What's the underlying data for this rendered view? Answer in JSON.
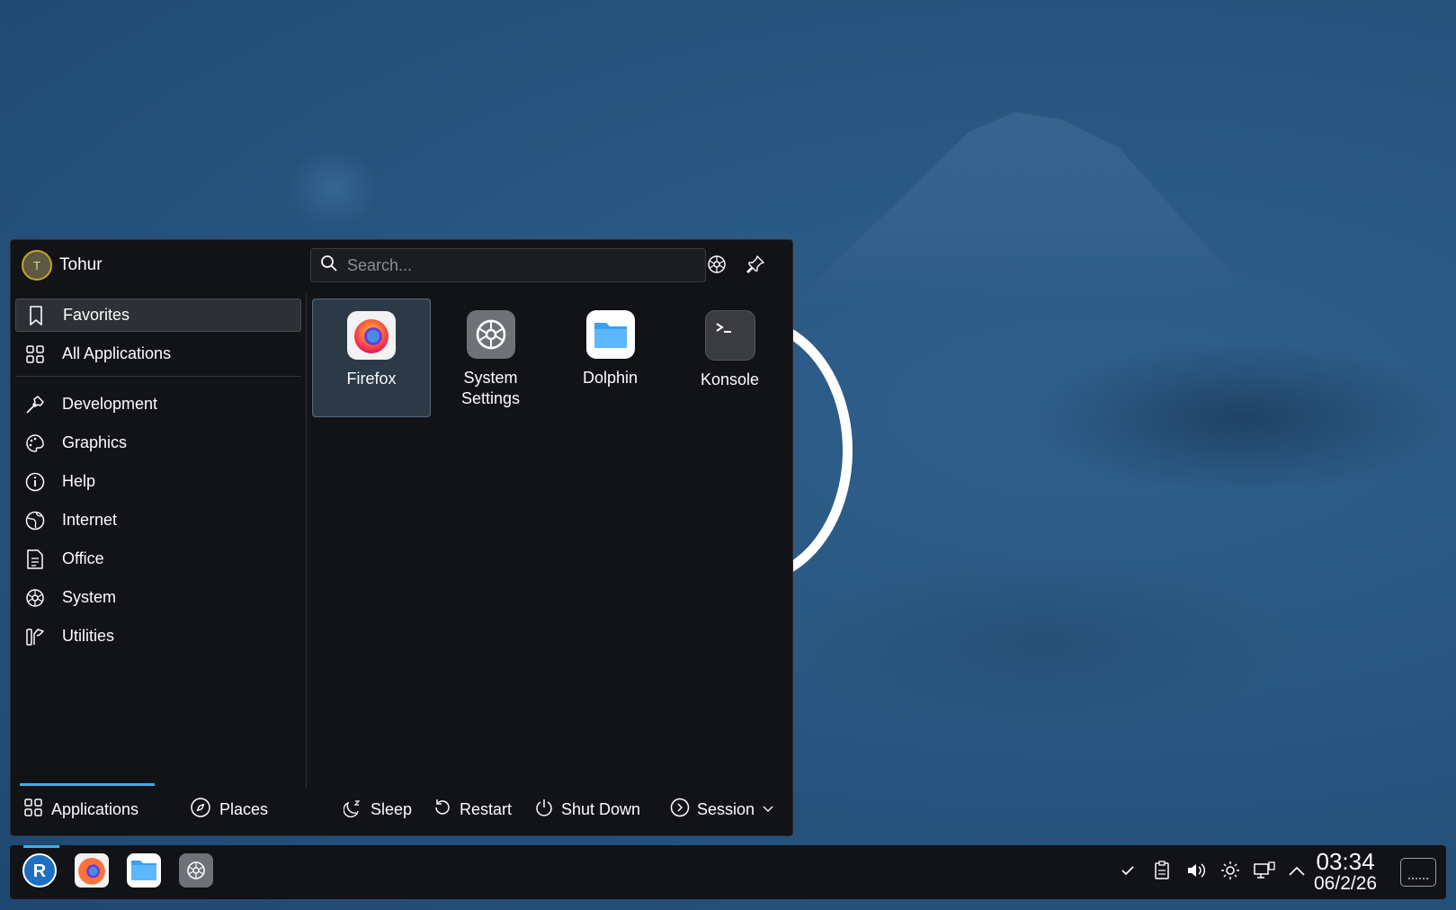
{
  "wallpaper": {
    "primary_color": "#2a5983",
    "accent_ring_color": "#ffffff"
  },
  "launcher": {
    "user_name": "Tohur",
    "avatar_initial": "T",
    "search_placeholder": "Search...",
    "header_icons": [
      "configure-icon",
      "pin-icon"
    ],
    "categories_top": [
      {
        "label": "Favorites",
        "icon": "bookmark-icon",
        "selected": true
      },
      {
        "label": "All Applications",
        "icon": "grid-icon",
        "selected": false
      }
    ],
    "categories": [
      {
        "label": "Development",
        "icon": "hammer-icon"
      },
      {
        "label": "Graphics",
        "icon": "palette-icon"
      },
      {
        "label": "Help",
        "icon": "info-icon"
      },
      {
        "label": "Internet",
        "icon": "globe-icon"
      },
      {
        "label": "Office",
        "icon": "document-icon"
      },
      {
        "label": "System",
        "icon": "gear-icon"
      },
      {
        "label": "Utilities",
        "icon": "tools-icon"
      }
    ],
    "favorites": [
      {
        "name": "Firefox",
        "icon": "firefox-icon",
        "selected": true
      },
      {
        "name": "System Settings",
        "line1": "System",
        "line2": "Settings",
        "icon": "settings-icon",
        "selected": false
      },
      {
        "name": "Dolphin",
        "icon": "folder-icon",
        "selected": false
      },
      {
        "name": "Konsole",
        "icon": "terminal-icon",
        "selected": false
      }
    ],
    "footer": {
      "tabs": [
        {
          "label": "Applications",
          "icon": "grid-icon",
          "active": true
        },
        {
          "label": "Places",
          "icon": "compass-icon",
          "active": false
        }
      ],
      "power": [
        {
          "label": "Sleep",
          "icon": "sleep-icon"
        },
        {
          "label": "Restart",
          "icon": "restart-icon"
        },
        {
          "label": "Shut Down",
          "icon": "power-icon"
        },
        {
          "label": "Session",
          "icon": "session-icon"
        }
      ]
    }
  },
  "taskbar": {
    "apps": [
      "launcher-icon",
      "firefox-icon",
      "folder-icon",
      "settings-icon"
    ],
    "tray": [
      "checkmark-icon",
      "clipboard-icon",
      "volume-icon",
      "brightness-icon",
      "network-icon",
      "chevron-up-icon"
    ],
    "time": "03:34",
    "date": "06/2/26",
    "accent_color": "#3daee9"
  }
}
